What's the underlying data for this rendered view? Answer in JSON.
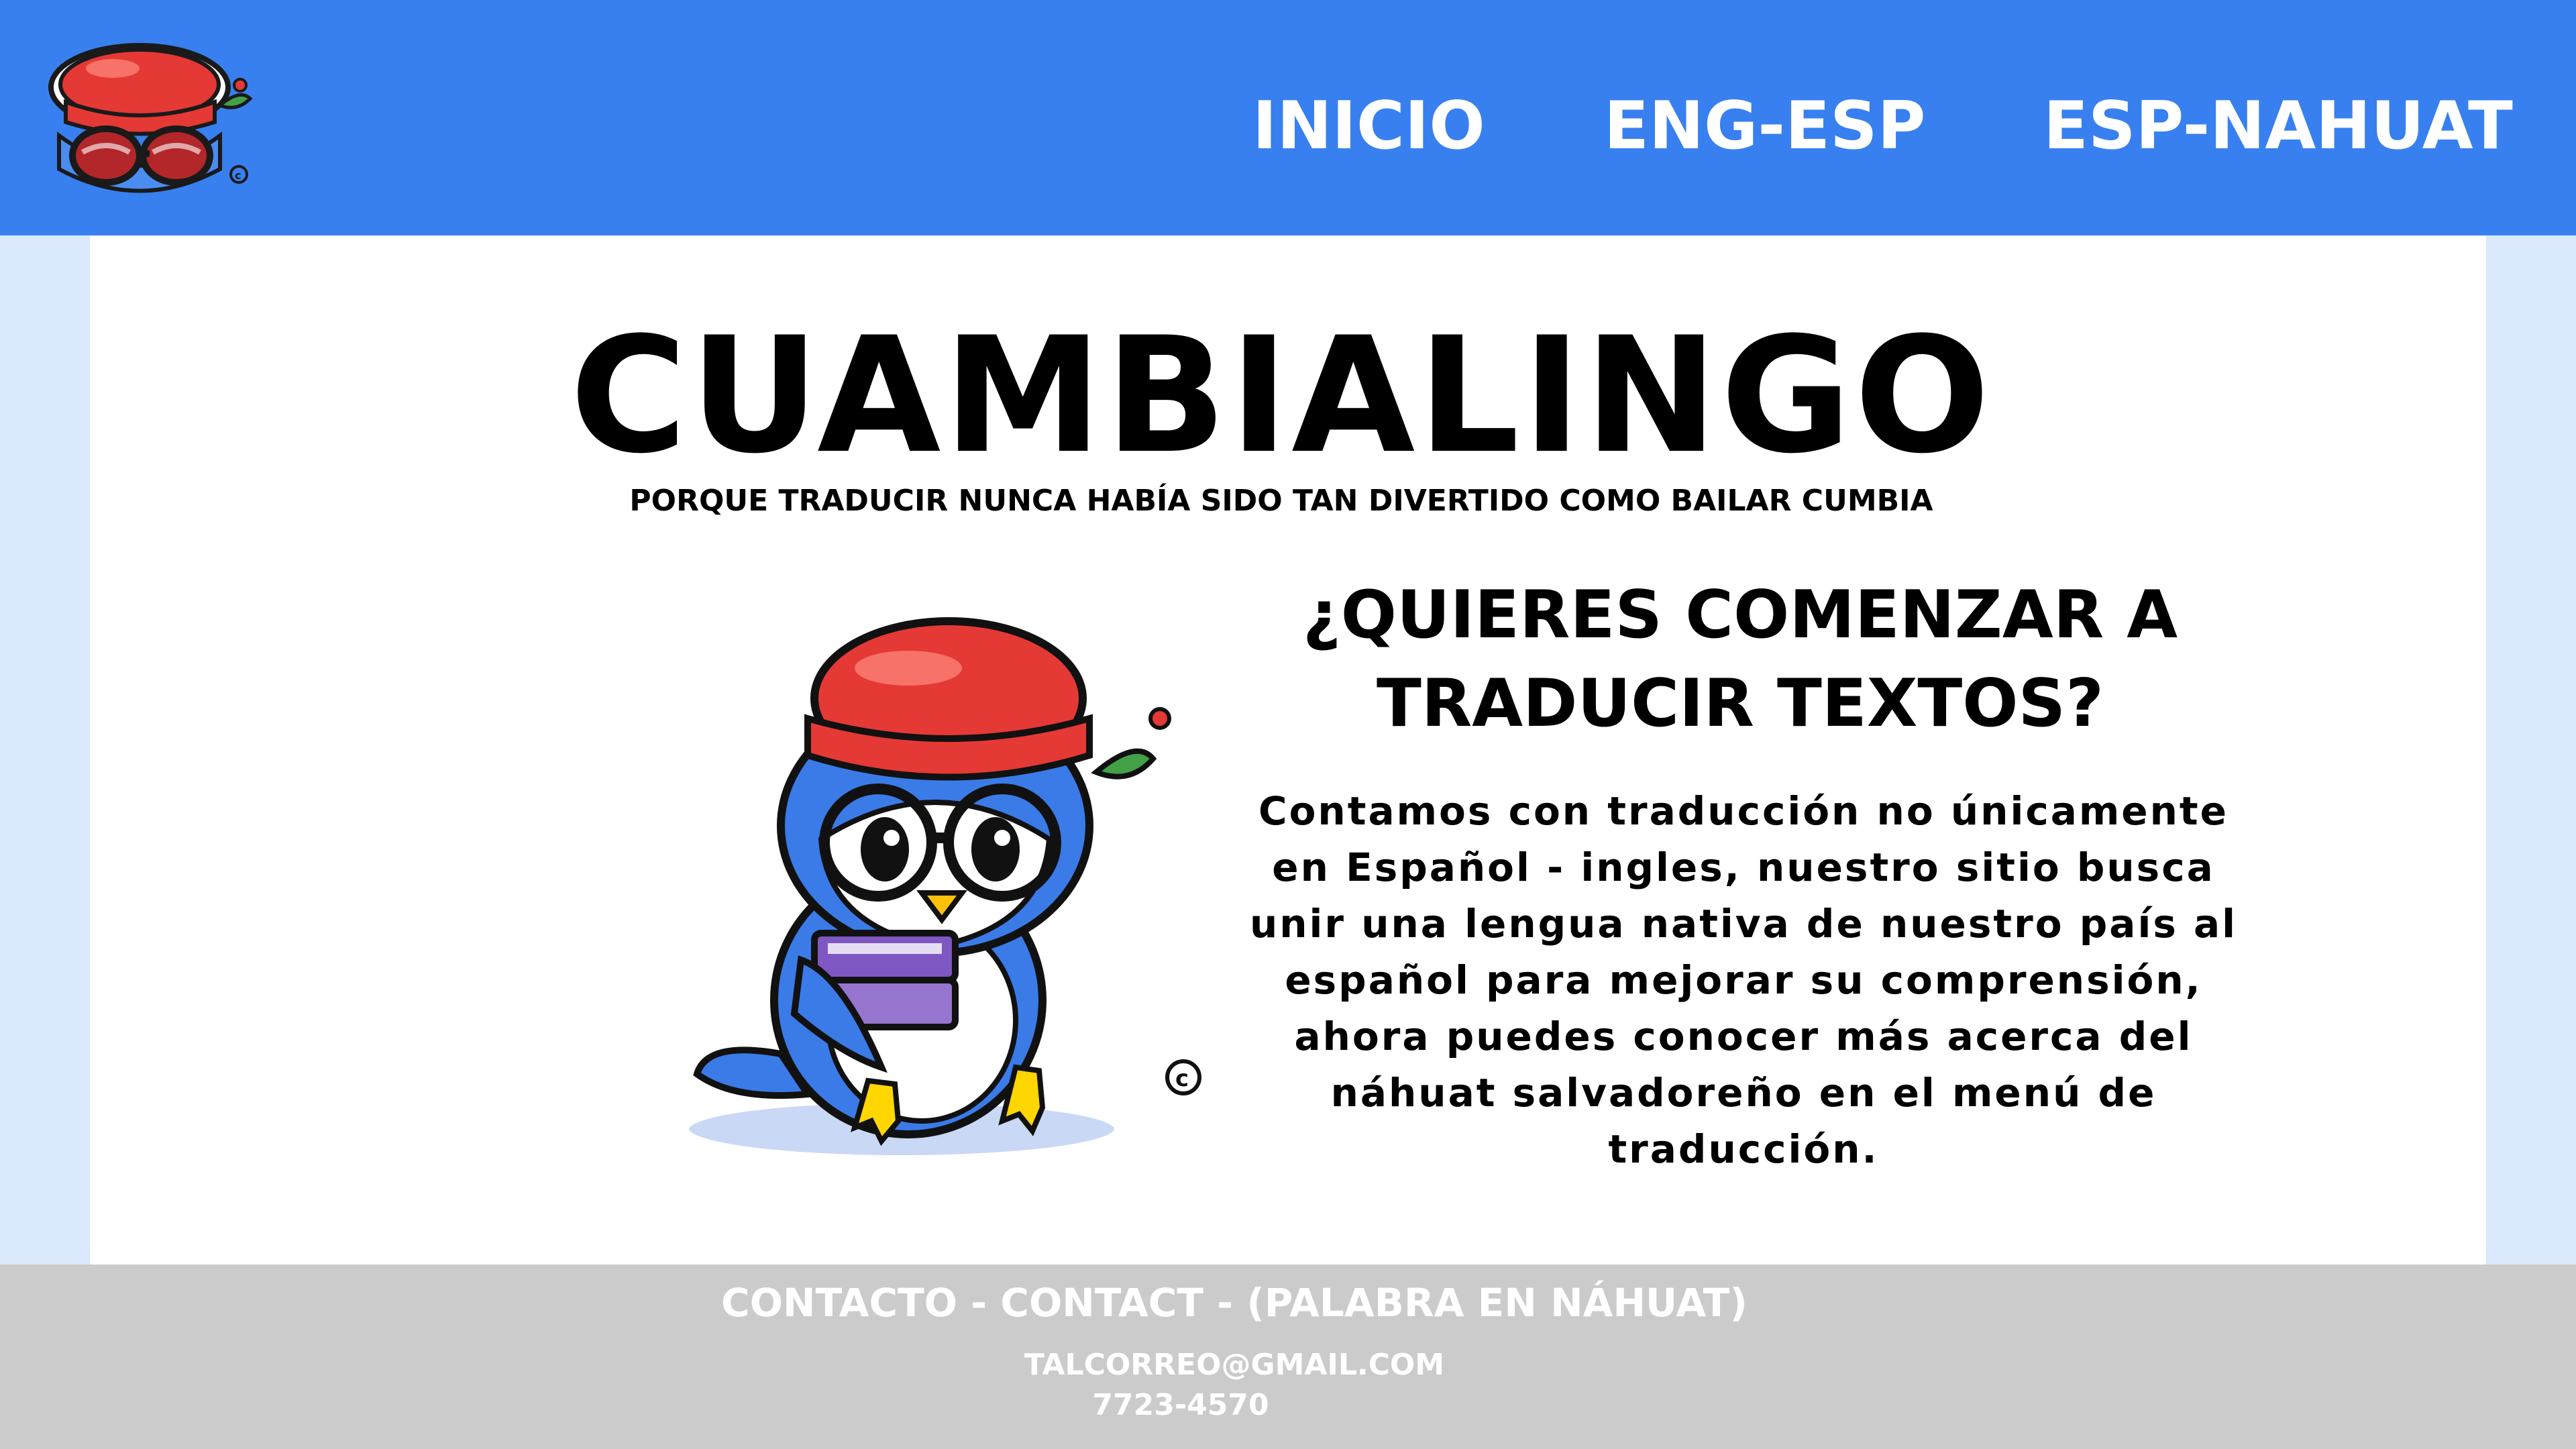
{
  "colors": {
    "header": "#3880ef",
    "background": "#dbe9fd",
    "content": "#ffffff",
    "footer": "#cbcbcb",
    "text": "#000000",
    "nav_text": "#ffffff"
  },
  "header": {
    "logo_icon": "penguin-hat-glasses-logo-icon",
    "nav": [
      {
        "label": "INICIO"
      },
      {
        "label": "ENG-ESP"
      },
      {
        "label": "ESP-NAHUAT"
      }
    ]
  },
  "main": {
    "title": "CUAMBIALINGO",
    "subtitle": "PORQUE TRADUCIR NUNCA HABÍA SIDO TAN DIVERTIDO COMO BAILAR CUMBIA",
    "mascot_icon": "penguin-mascot-reading-book-icon",
    "heading_line1": "¿QUIERES COMENZAR A",
    "heading_line2": "TRADUCIR TEXTOS?",
    "body_lines": [
      "Contamos con traducción no únicamente",
      "en Español - ingles, nuestro sitio busca",
      "unir una lengua nativa de nuestro país al",
      "español para mejorar su comprensión,",
      "ahora puedes conocer más acerca del",
      "náhuat salvadoreño en el menú de",
      "traducción."
    ]
  },
  "footer": {
    "title": "CONTACTO - CONTACT - (PALABRA EN NÁHUAT)",
    "email": "TALCORREO@GMAIL.COM",
    "phone": "7723-4570"
  }
}
